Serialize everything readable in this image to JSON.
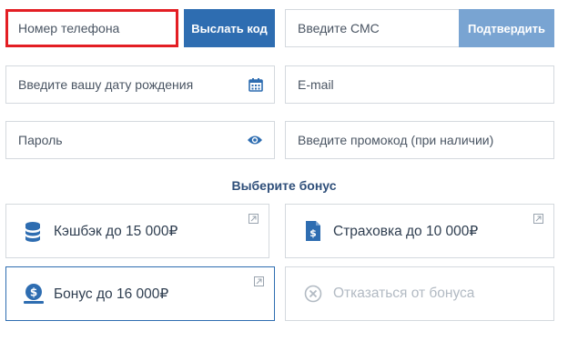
{
  "form": {
    "phone_placeholder": "Номер телефона",
    "send_code_button": "Выслать код",
    "sms_placeholder": "Введите СМС",
    "confirm_button": "Подтвердить",
    "birthdate_placeholder": "Введите вашу дату рождения",
    "email_placeholder": "E-mail",
    "password_placeholder": "Пароль",
    "promo_placeholder": "Введите промокод (при наличии)"
  },
  "bonus_section": {
    "title": "Выберите бонус",
    "options": [
      {
        "label": "Кэшбэк до 15 000₽",
        "icon": "coins-stack-icon"
      },
      {
        "label": "Страховка до 10 000₽",
        "icon": "insurance-document-icon"
      },
      {
        "label": "Бонус до 16 000₽",
        "icon": "money-bag-icon",
        "selected": true
      },
      {
        "label": "Отказаться от бонуса",
        "icon": "cancel-circle-icon"
      }
    ]
  },
  "colors": {
    "primary": "#2e6db1",
    "primary_light": "#79a4d2",
    "error_border": "#e31e24",
    "border": "#d4d9de",
    "title_text": "#2f4f7a"
  }
}
